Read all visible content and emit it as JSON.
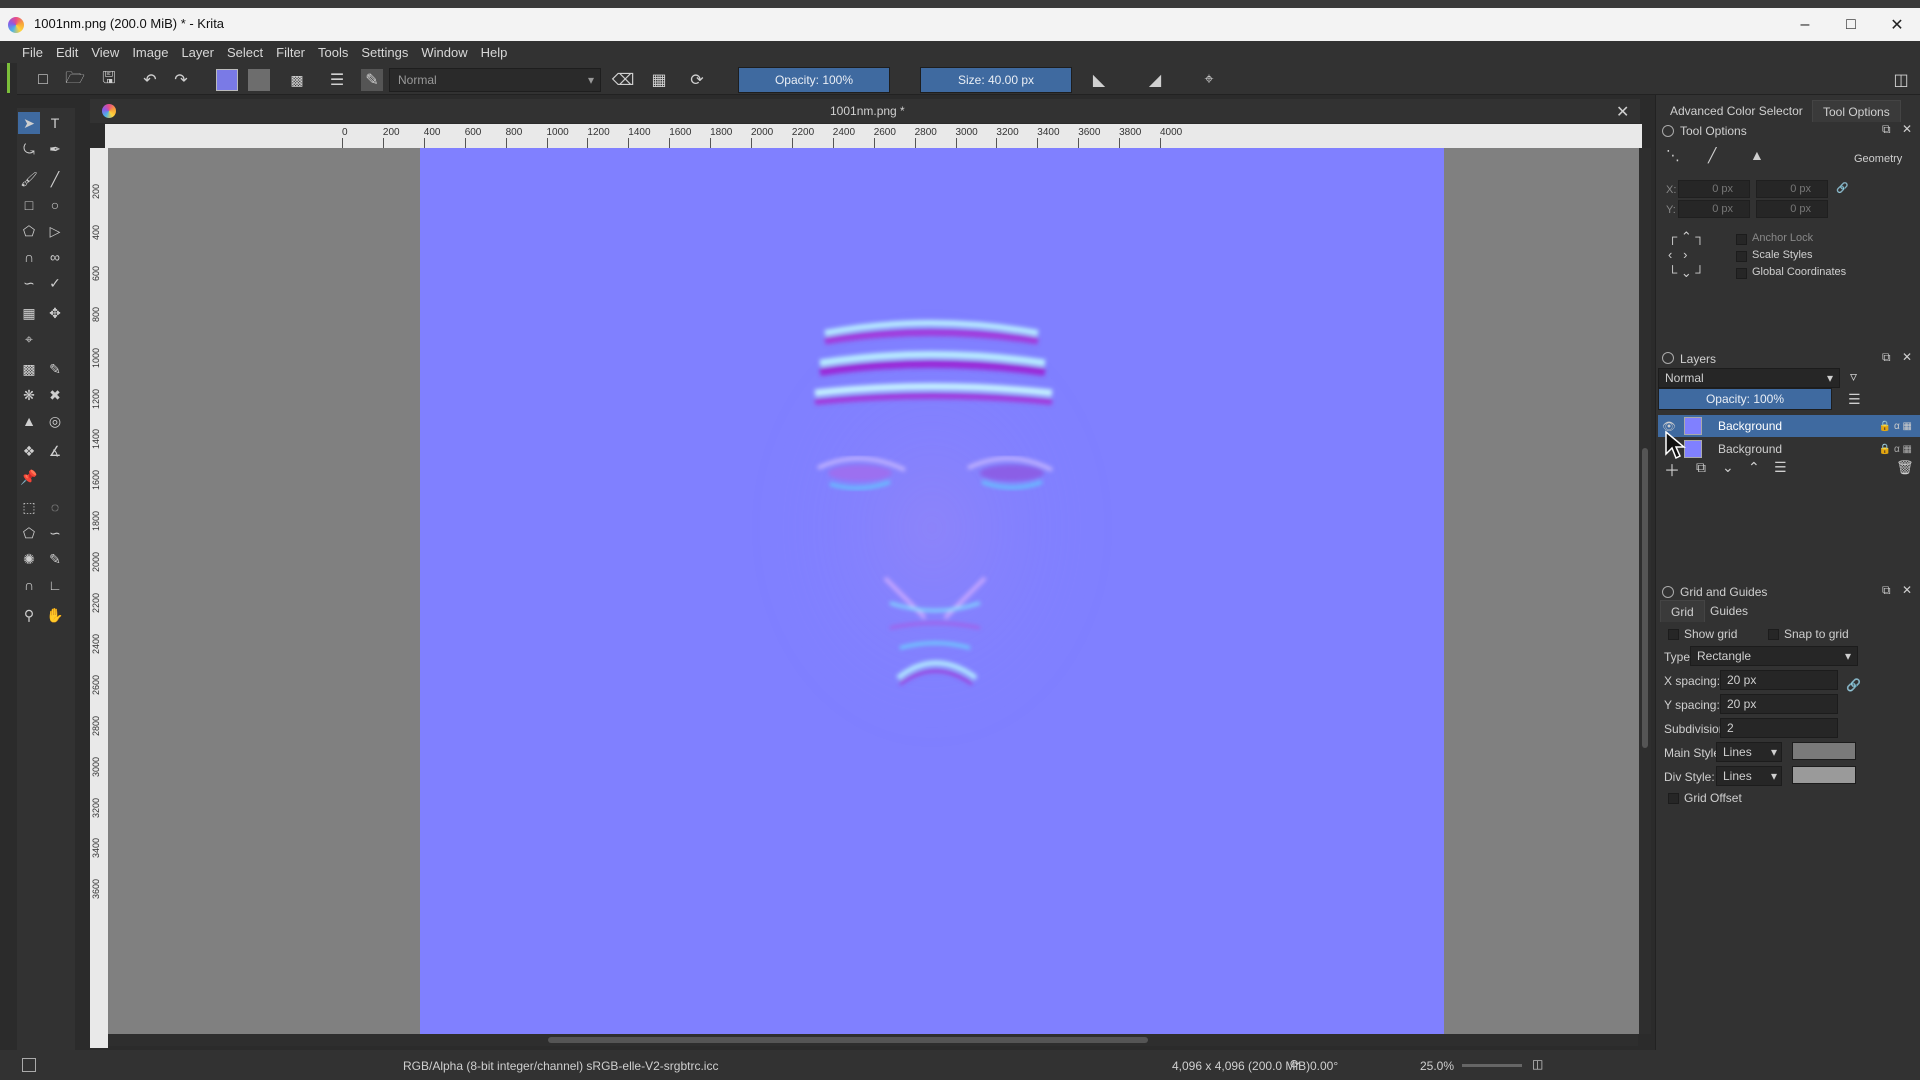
{
  "window": {
    "title": "1001nm.png (200.0 MiB)  * - Krita",
    "minimize": "–",
    "maximize": "□",
    "close": "✕"
  },
  "menu": [
    "File",
    "Edit",
    "View",
    "Image",
    "Layer",
    "Select",
    "Filter",
    "Tools",
    "Settings",
    "Window",
    "Help"
  ],
  "toolbar": {
    "blend_mode": "Normal",
    "opacity_label": "Opacity: 100%",
    "size_label": "Size: 40.00 px"
  },
  "document": {
    "tab_name": "1001nm.png *",
    "h_ruler_ticks": [
      "0",
      "200",
      "400",
      "600",
      "800",
      "1000",
      "1200",
      "1400",
      "1600",
      "1800",
      "2000",
      "2200",
      "2400",
      "2600",
      "2800",
      "3000",
      "3200",
      "3400",
      "3600",
      "3800",
      "4000"
    ],
    "v_ruler_ticks": [
      "200",
      "400",
      "600",
      "800",
      "1000",
      "1200",
      "1400",
      "1600",
      "1800",
      "2000",
      "2200",
      "2400",
      "2600",
      "2800",
      "3000",
      "3200",
      "3400",
      "3600"
    ]
  },
  "dock": {
    "tabs": [
      "Advanced Color Selector",
      "Tool Options"
    ],
    "tool_options": {
      "title": "Tool Options",
      "geometry_label": "Geometry",
      "x_label": "X:",
      "y_label": "Y:",
      "x_value": "0 px",
      "x2_value": "0 px",
      "y_value": "0 px",
      "y2_value": "0 px",
      "anchor_lock": "Anchor Lock",
      "scale_styles": "Scale Styles",
      "global_coordinates": "Global Coordinates"
    },
    "layers": {
      "title": "Layers",
      "blend_mode": "Normal",
      "opacity_label": "Opacity:  100%",
      "items": [
        {
          "name": "Background",
          "selected": true
        },
        {
          "name": "Background",
          "selected": false
        }
      ]
    },
    "grid": {
      "title": "Grid and Guides",
      "tabs": [
        "Grid",
        "Guides"
      ],
      "show_grid": "Show grid",
      "snap_to_grid": "Snap to grid",
      "type_label": "Type:",
      "type_value": "Rectangle",
      "x_spacing_label": "X spacing:",
      "x_spacing_value": "20 px",
      "y_spacing_label": "Y spacing:",
      "y_spacing_value": "20 px",
      "subdivision_label": "Subdivision:",
      "subdivision_value": "2",
      "main_style_label": "Main Style:",
      "main_style_value": "Lines",
      "div_style_label": "Div Style:",
      "div_style_value": "Lines",
      "grid_offset": "Grid Offset"
    }
  },
  "status": {
    "color_profile": "RGB/Alpha (8-bit integer/channel)  sRGB-elle-V2-srgbtrc.icc",
    "dimensions": "4,096 x 4,096 (200.0 MiB)",
    "rotation": "0.00°",
    "zoom": "25.0%"
  },
  "colors": {
    "normal_map": "#8080ff",
    "accent": "#3f6aa0",
    "panel": "#323232"
  }
}
